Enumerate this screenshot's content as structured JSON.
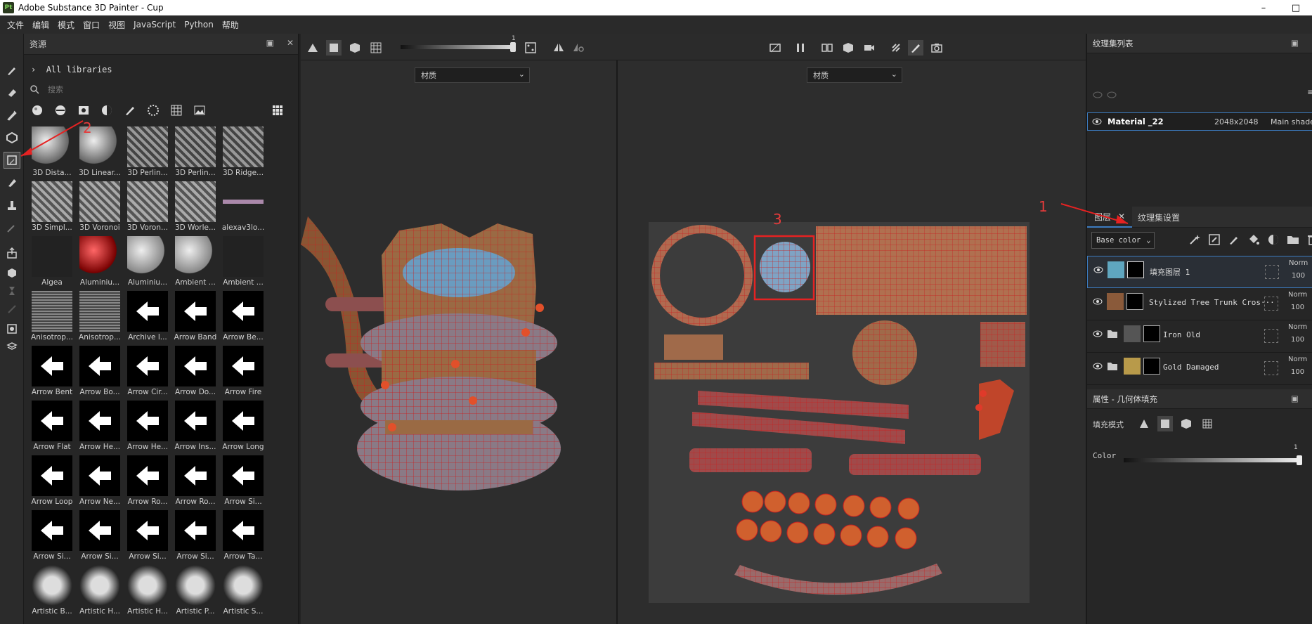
{
  "window": {
    "title": "Adobe Substance 3D Painter - Cup",
    "logo": "Pt"
  },
  "menu": [
    "文件",
    "编辑",
    "模式",
    "窗口",
    "视图",
    "JavaScript",
    "Python",
    "帮助"
  ],
  "assets": {
    "title": "资源",
    "library": "All libraries",
    "search_placeholder": "搜索",
    "items": [
      "3D Dista...",
      "3D Linear...",
      "3D Perlin...",
      "3D Perlin...",
      "3D Ridge...",
      "3D Simpl...",
      "3D Voronoi",
      "3D Voron...",
      "3D Worle...",
      "alexav3lo...",
      "Algea",
      "Aluminiu...",
      "Aluminiu...",
      "Ambient ...",
      "Ambient ...",
      "Anisotrop...",
      "Anisotrop...",
      "Archive l...",
      "Arrow Band",
      "Arrow Be...",
      "Arrow Bent",
      "Arrow Bo...",
      "Arrow Cir...",
      "Arrow Do...",
      "Arrow Fire",
      "Arrow Flat",
      "Arrow He...",
      "Arrow He...",
      "Arrow Ins...",
      "Arrow Long",
      "Arrow Loop",
      "Arrow Ne...",
      "Arrow Ro...",
      "Arrow Ro...",
      "Arrow Si...",
      "Arrow Si...",
      "Arrow Si...",
      "Arrow Si...",
      "Arrow Si...",
      "Arrow Ta...",
      "Artistic B...",
      "Artistic H...",
      "Artistic H...",
      "Artistic P...",
      "Artistic S..."
    ]
  },
  "viewport": {
    "slider_value": "1",
    "left_select": "材质",
    "right_select": "材质"
  },
  "annotations": {
    "one": "1",
    "two": "2",
    "three": "3"
  },
  "texture_sets": {
    "title": "纹理集列表",
    "row": {
      "name": "Material _22",
      "resolution": "2048x2048",
      "shader": "Main shade"
    }
  },
  "layers": {
    "tab_layers": "图层",
    "tab_settings": "纹理集设置",
    "channel": "Base color",
    "items": [
      {
        "name": "填充图层 1",
        "blend": "Norm",
        "opacity": "100"
      },
      {
        "name": "Stylized Tree Trunk Cros···",
        "blend": "Norm",
        "opacity": "100"
      },
      {
        "name": "Iron Old",
        "blend": "Norm",
        "opacity": "100"
      },
      {
        "name": "Gold Damaged",
        "blend": "Norm",
        "opacity": "100"
      }
    ]
  },
  "properties": {
    "title": "属性 - 几何体填充",
    "fill_mode_label": "填充模式",
    "color_label": "Color",
    "color_value": "1"
  }
}
